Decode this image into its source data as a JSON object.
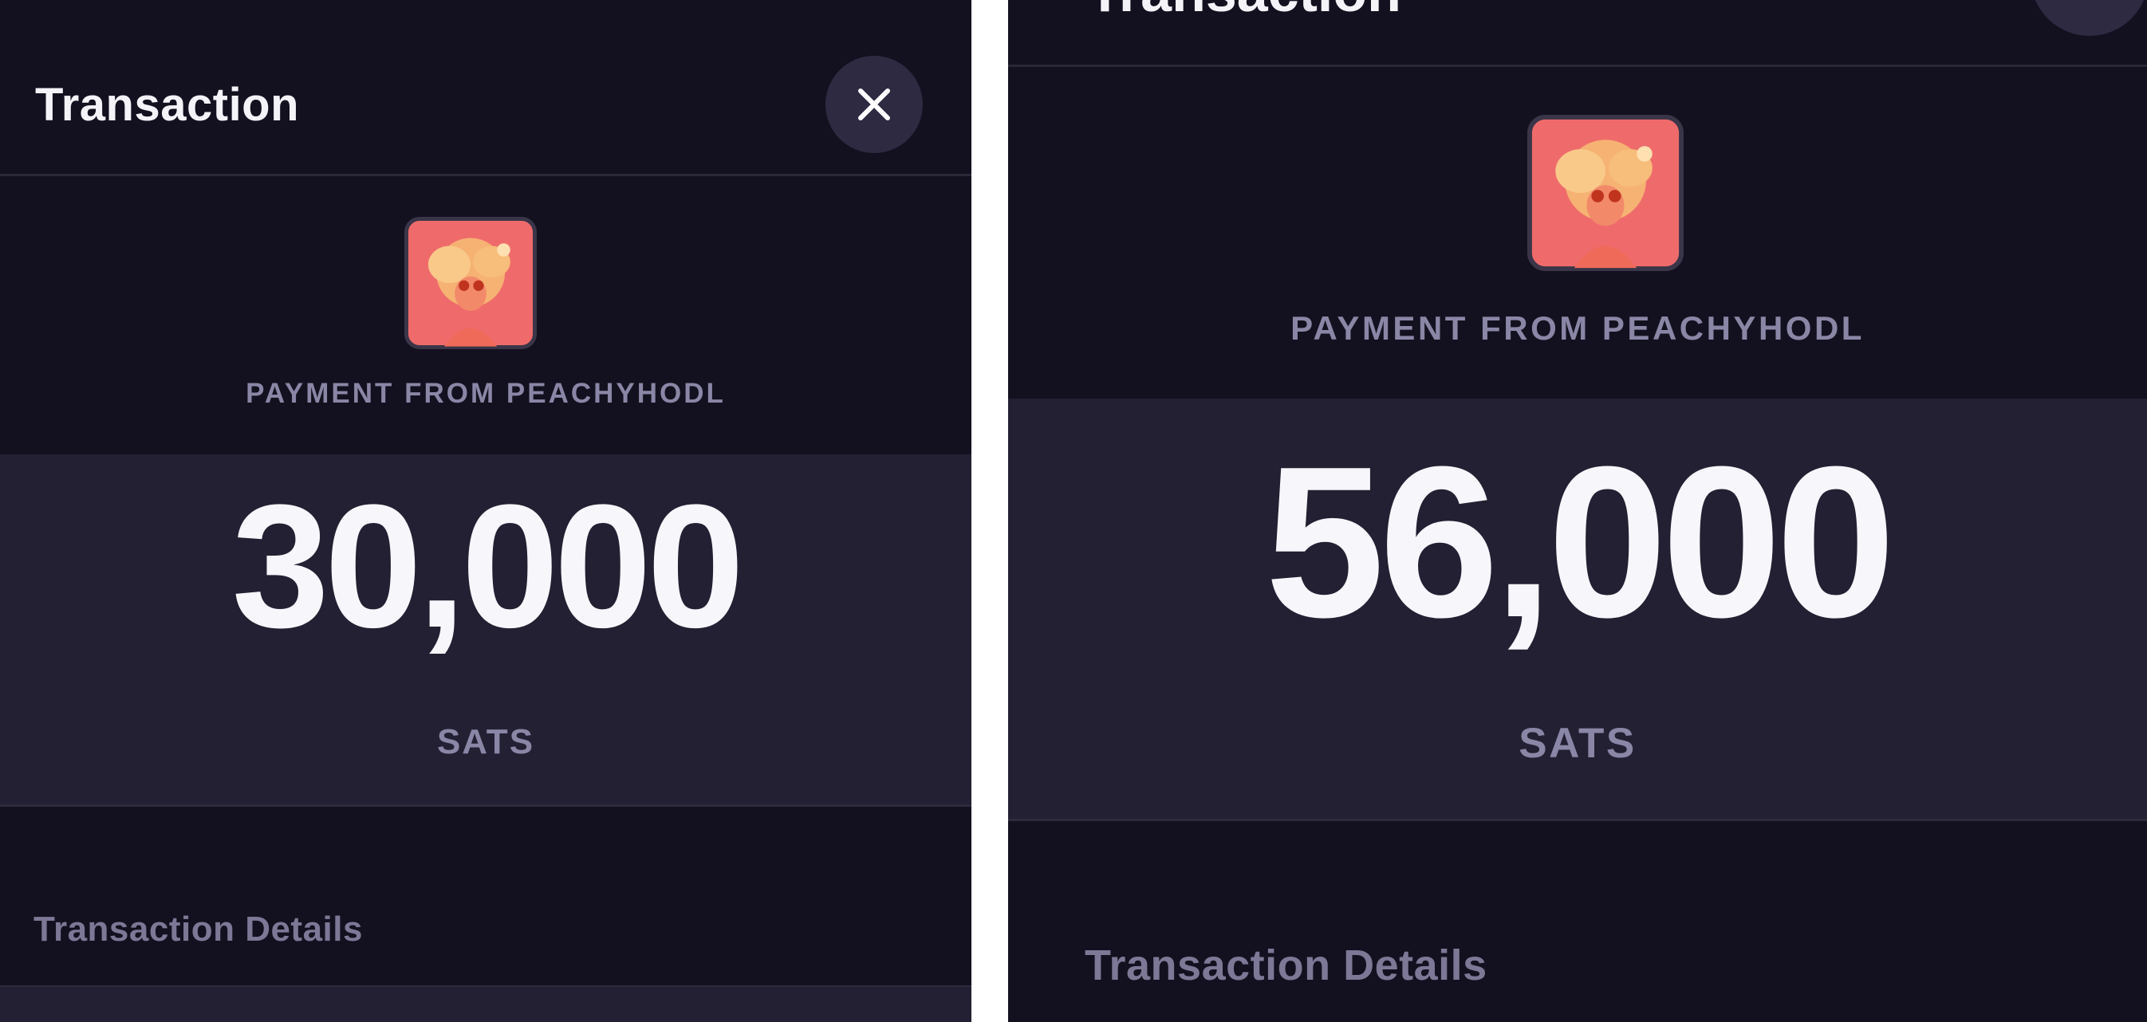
{
  "screens": [
    {
      "header": {
        "title": "Transaction",
        "close_icon": "close-icon"
      },
      "payment": {
        "from_label": "PAYMENT FROM PEACHYHODL",
        "avatar_icon": "peach-avatar"
      },
      "amount": {
        "value": "30,000",
        "unit": "SATS"
      },
      "details": {
        "heading": "Transaction Details"
      }
    },
    {
      "header": {
        "title": "Transaction",
        "close_icon": "close-icon"
      },
      "payment": {
        "from_label": "PAYMENT FROM PEACHYHODL",
        "avatar_icon": "peach-avatar"
      },
      "amount": {
        "value": "56,000",
        "unit": "SATS"
      },
      "details": {
        "heading": "Transaction Details"
      }
    }
  ],
  "colors": {
    "background": "#13111f",
    "band": "#232033",
    "close_button": "#2d2a42",
    "primary_text": "#f7f6fa",
    "muted_text": "#8a86a6",
    "avatar_bg": "#ef6b6b"
  }
}
